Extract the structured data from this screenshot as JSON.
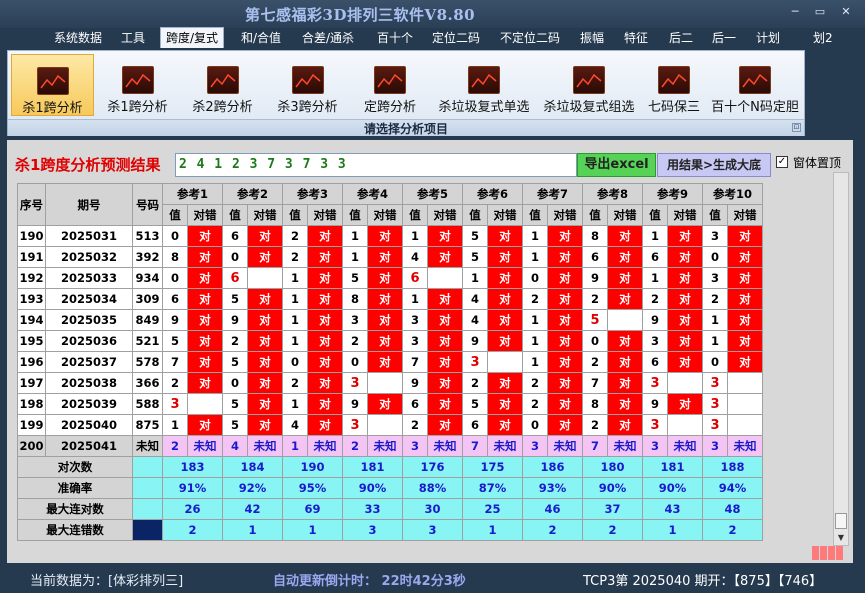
{
  "window": {
    "title": "第七感福彩3D排列三软件V8.80",
    "min": "─",
    "max": "▭",
    "close": "✕"
  },
  "menu": [
    "系统数据",
    "工具",
    "跨度/复式",
    "和/合值",
    "合差/通杀",
    "百十个",
    "定位二码",
    "不定位二码",
    "振幅",
    "特征",
    "后二",
    "后一",
    "计划",
    "划2"
  ],
  "ribbon": {
    "buttons": [
      "杀1跨分析",
      "杀1跨分析",
      "杀2跨分析",
      "杀3跨分析",
      "定跨分析",
      "杀垃圾复式单选",
      "杀垃圾复式组选",
      "七码保三",
      "百十个N码定胆"
    ],
    "group_label": "请选择分析项目",
    "expand": "⊡"
  },
  "results": {
    "title": "杀1跨度分析预测结果",
    "prediction": "2 4 1 2 3 7 3 7 3 3",
    "export_label": "导出excel",
    "generate_label": "用结果>生成大底",
    "pin_label": "窗体置顶",
    "pin_checked": "✓"
  },
  "table": {
    "headers": {
      "idx": "序号",
      "date": "期号",
      "code": "号码",
      "val": "值",
      "res": "对错",
      "refs": [
        "参考1",
        "参考2",
        "参考3",
        "参考4",
        "参考5",
        "参考6",
        "参考7",
        "参考8",
        "参考9",
        "参考10"
      ]
    },
    "rows": [
      {
        "idx": "190",
        "date": "2025031",
        "code": "513",
        "v": [
          "0",
          "6",
          "2",
          "1",
          "1",
          "5",
          "1",
          "8",
          "1",
          "3"
        ],
        "r": [
          "对",
          "对",
          "对",
          "对",
          "对",
          "对",
          "对",
          "对",
          "对",
          "对"
        ],
        "hit": [
          1,
          1,
          1,
          1,
          1,
          1,
          1,
          1,
          1,
          1
        ]
      },
      {
        "idx": "191",
        "date": "2025032",
        "code": "392",
        "v": [
          "8",
          "0",
          "2",
          "1",
          "4",
          "5",
          "1",
          "6",
          "6",
          "0"
        ],
        "r": [
          "对",
          "对",
          "对",
          "对",
          "对",
          "对",
          "对",
          "对",
          "对",
          "对"
        ],
        "hit": [
          1,
          1,
          1,
          1,
          1,
          1,
          1,
          1,
          1,
          1
        ]
      },
      {
        "idx": "192",
        "date": "2025033",
        "code": "934",
        "v": [
          "0",
          "6",
          "1",
          "5",
          "6",
          "1",
          "0",
          "9",
          "1",
          "3"
        ],
        "r": [
          "对",
          "",
          "对",
          "对",
          "",
          "对",
          "对",
          "对",
          "对",
          "对"
        ],
        "hit": [
          1,
          0,
          1,
          1,
          0,
          1,
          1,
          1,
          1,
          1
        ]
      },
      {
        "idx": "193",
        "date": "2025034",
        "code": "309",
        "v": [
          "6",
          "5",
          "1",
          "8",
          "1",
          "4",
          "2",
          "2",
          "2",
          "2"
        ],
        "r": [
          "对",
          "对",
          "对",
          "对",
          "对",
          "对",
          "对",
          "对",
          "对",
          "对"
        ],
        "hit": [
          1,
          1,
          1,
          1,
          1,
          1,
          1,
          1,
          1,
          1
        ]
      },
      {
        "idx": "194",
        "date": "2025035",
        "code": "849",
        "v": [
          "9",
          "9",
          "1",
          "3",
          "3",
          "4",
          "1",
          "5",
          "9",
          "1"
        ],
        "r": [
          "对",
          "对",
          "对",
          "对",
          "对",
          "对",
          "对",
          "",
          "对",
          "对"
        ],
        "hit": [
          1,
          1,
          1,
          1,
          1,
          1,
          1,
          0,
          1,
          1
        ]
      },
      {
        "idx": "195",
        "date": "2025036",
        "code": "521",
        "v": [
          "5",
          "2",
          "1",
          "2",
          "3",
          "9",
          "1",
          "0",
          "3",
          "1"
        ],
        "r": [
          "对",
          "对",
          "对",
          "对",
          "对",
          "对",
          "对",
          "对",
          "对",
          "对"
        ],
        "hit": [
          1,
          1,
          1,
          1,
          1,
          1,
          1,
          1,
          1,
          1
        ]
      },
      {
        "idx": "196",
        "date": "2025037",
        "code": "578",
        "v": [
          "7",
          "5",
          "0",
          "0",
          "7",
          "3",
          "1",
          "2",
          "6",
          "0"
        ],
        "r": [
          "对",
          "对",
          "对",
          "对",
          "对",
          "",
          "对",
          "对",
          "对",
          "对"
        ],
        "hit": [
          1,
          1,
          1,
          1,
          1,
          0,
          1,
          1,
          1,
          1
        ]
      },
      {
        "idx": "197",
        "date": "2025038",
        "code": "366",
        "v": [
          "2",
          "0",
          "2",
          "3",
          "9",
          "2",
          "2",
          "7",
          "3",
          "3"
        ],
        "r": [
          "对",
          "对",
          "对",
          "",
          "对",
          "对",
          "对",
          "对",
          "",
          ""
        ],
        "hit": [
          1,
          1,
          1,
          0,
          1,
          1,
          1,
          1,
          0,
          0
        ]
      },
      {
        "idx": "198",
        "date": "2025039",
        "code": "588",
        "v": [
          "3",
          "5",
          "1",
          "9",
          "6",
          "5",
          "2",
          "8",
          "9",
          "3"
        ],
        "r": [
          "",
          "对",
          "对",
          "对",
          "对",
          "对",
          "对",
          "对",
          "对",
          ""
        ],
        "hit": [
          0,
          1,
          1,
          1,
          1,
          1,
          1,
          1,
          1,
          0
        ]
      },
      {
        "idx": "199",
        "date": "2025040",
        "code": "875",
        "v": [
          "1",
          "5",
          "4",
          "3",
          "2",
          "6",
          "0",
          "2",
          "3",
          "3"
        ],
        "r": [
          "对",
          "对",
          "对",
          "",
          "对",
          "对",
          "对",
          "对",
          "",
          ""
        ],
        "hit": [
          1,
          1,
          1,
          0,
          1,
          1,
          1,
          1,
          0,
          0
        ]
      }
    ],
    "pred_row": {
      "idx": "200",
      "date": "2025041",
      "code": "未知",
      "v": [
        "2",
        "4",
        "1",
        "2",
        "3",
        "7",
        "3",
        "7",
        "3",
        "3"
      ],
      "r": "未知"
    },
    "stats": [
      {
        "label": "对次数",
        "values": [
          "183",
          "184",
          "190",
          "181",
          "176",
          "175",
          "186",
          "180",
          "181",
          "188"
        ]
      },
      {
        "label": "准确率",
        "values": [
          "91%",
          "92%",
          "95%",
          "90%",
          "88%",
          "87%",
          "93%",
          "90%",
          "90%",
          "94%"
        ]
      },
      {
        "label": "最大连对数",
        "values": [
          "26",
          "42",
          "69",
          "33",
          "30",
          "25",
          "46",
          "37",
          "43",
          "48"
        ]
      },
      {
        "label": "最大连错数",
        "values": [
          "2",
          "1",
          "1",
          "3",
          "3",
          "1",
          "2",
          "2",
          "1",
          "2"
        ]
      }
    ],
    "miss_values": [
      "6",
      "6",
      "5",
      "6",
      "3",
      "3",
      "3",
      "3",
      "3",
      "3",
      "3",
      "3"
    ]
  },
  "status": {
    "source": "当前数据为：[体彩排列三]",
    "countdown": "自动更新倒计时：  22时42分3秒",
    "draw": "TCP3第 2025040 期开：【875】【746】"
  },
  "colors": {
    "hit": "#ff0000",
    "prediction_row": "#f4c4f4",
    "stats": "#88f4f4",
    "accent_title": "#e00000",
    "export": "#56d356"
  }
}
